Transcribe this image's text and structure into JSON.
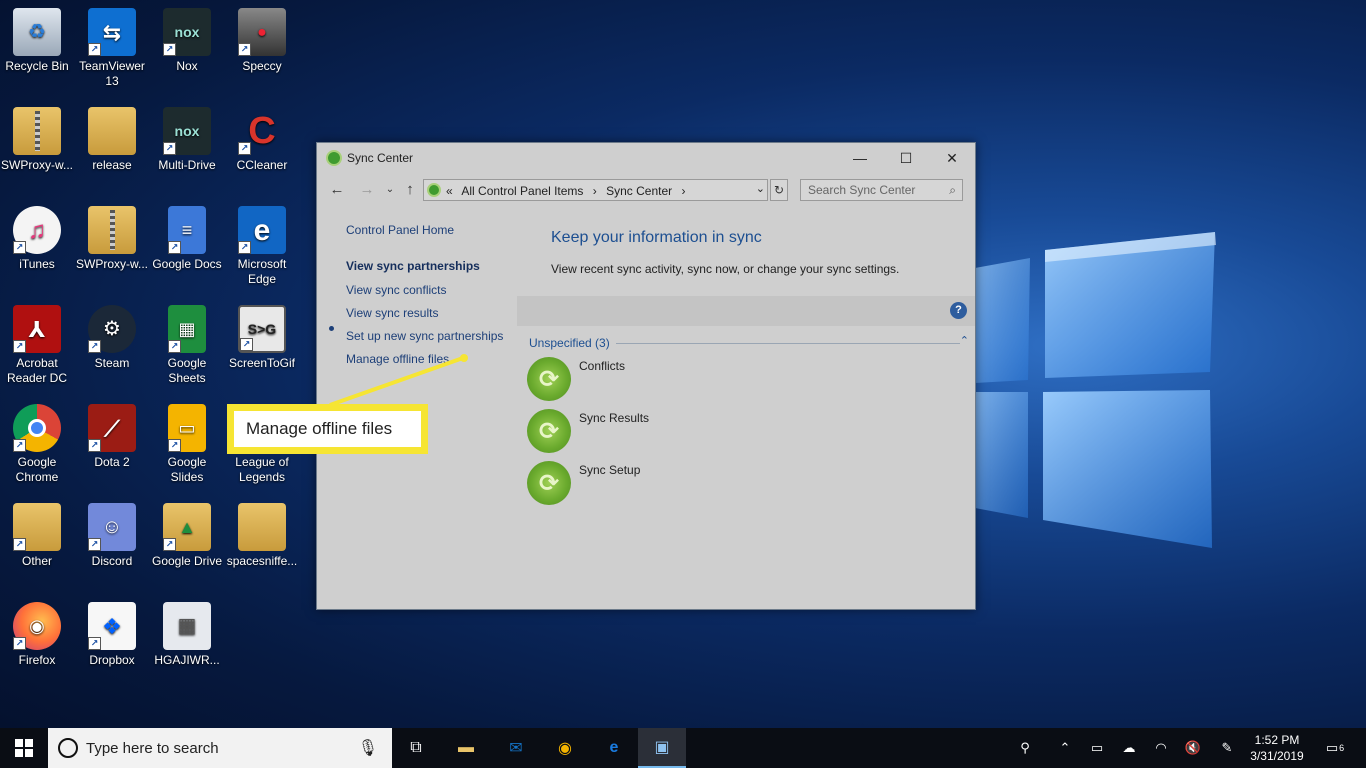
{
  "desktop": {
    "icons": [
      {
        "label": "Recycle Bin"
      },
      {
        "label": "TeamViewer 13"
      },
      {
        "label": "Nox"
      },
      {
        "label": "Speccy"
      },
      {
        "label": "SWProxy-w..."
      },
      {
        "label": "release"
      },
      {
        "label": "Multi-Drive"
      },
      {
        "label": "CCleaner"
      },
      {
        "label": "iTunes"
      },
      {
        "label": "SWProxy-w..."
      },
      {
        "label": "Google Docs"
      },
      {
        "label": "Microsoft Edge"
      },
      {
        "label": "Acrobat Reader DC"
      },
      {
        "label": "Steam"
      },
      {
        "label": "Google Sheets"
      },
      {
        "label": "ScreenToGif"
      },
      {
        "label": "Google Chrome"
      },
      {
        "label": "Dota 2"
      },
      {
        "label": "Google Slides"
      },
      {
        "label": "League of Legends"
      },
      {
        "label": "Other"
      },
      {
        "label": "Discord"
      },
      {
        "label": "Google Drive"
      },
      {
        "label": "spacesniffe..."
      },
      {
        "label": "Firefox"
      },
      {
        "label": "Dropbox"
      },
      {
        "label": "HGAJIWR..."
      }
    ]
  },
  "window": {
    "title": "Sync Center",
    "address": {
      "overflow": "«",
      "crumb1": "All Control Panel Items",
      "sep": "›",
      "crumb2": "Sync Center"
    },
    "search_placeholder": "Search Sync Center",
    "nav": {
      "home": "Control Panel Home",
      "partnerships": "View sync partnerships",
      "conflicts": "View sync conflicts",
      "results": "View sync results",
      "setup": "Set up new sync partnerships",
      "offline": "Manage offline files"
    },
    "heading": "Keep your information in sync",
    "subtext": "View recent sync activity, sync now, or change your sync settings.",
    "group_label": "Unspecified (3)",
    "items": [
      {
        "label": "Conflicts"
      },
      {
        "label": "Sync Results"
      },
      {
        "label": "Sync Setup"
      }
    ]
  },
  "callout": {
    "text": "Manage offline files",
    "color": "#f6e533"
  },
  "taskbar": {
    "search_placeholder": "Type here to search",
    "time": "1:52 PM",
    "date": "3/31/2019",
    "notification_count": "6"
  }
}
